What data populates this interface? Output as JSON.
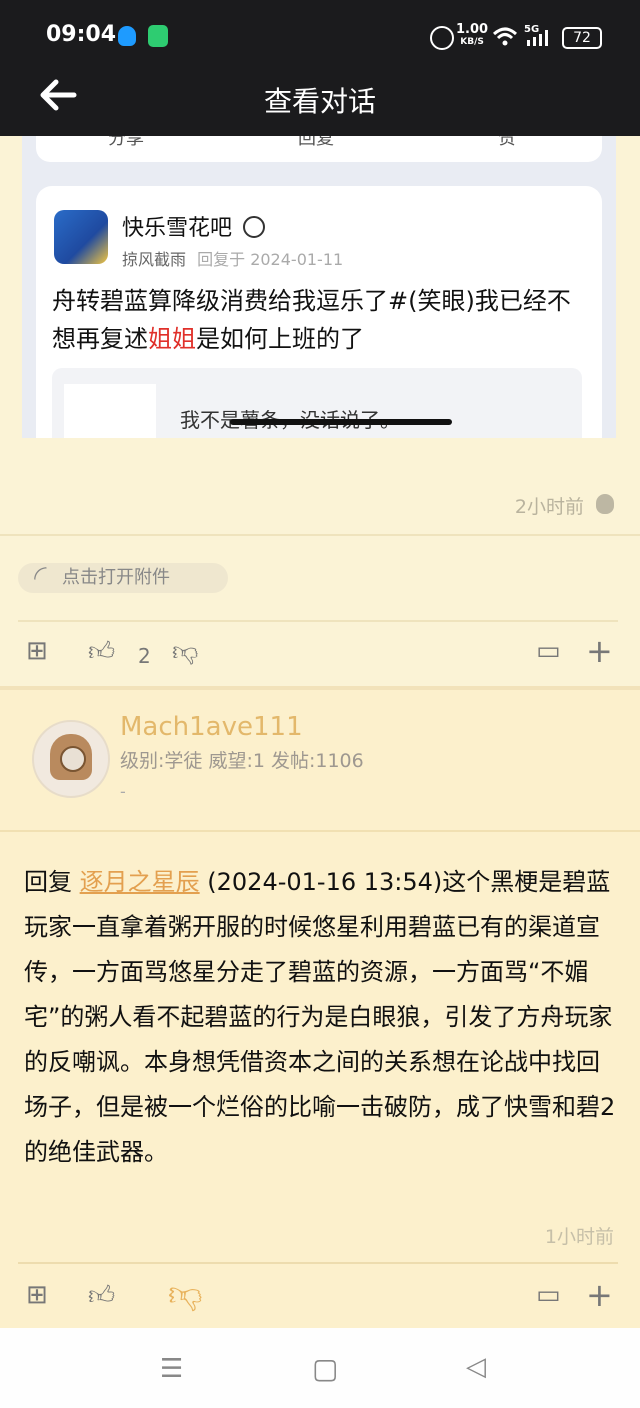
{
  "status": {
    "time": "09:04",
    "net_speed": "1.00",
    "net_unit": "KB/S",
    "network": "5G",
    "battery": "72"
  },
  "header": {
    "title": "查看对话",
    "back_icon": "arrow-left-icon"
  },
  "embedded": {
    "actions": [
      "分享",
      "回复",
      "赞"
    ],
    "forum_name": "快乐雪花吧",
    "author": "掠风截雨",
    "reply_meta": "回复于 2024-01-11",
    "text_before": "舟转碧蓝算降级消费给我逗乐了#(笑眼)我已经不想再复述",
    "text_highlight": "姐姐",
    "text_after": "是如何上班的了",
    "quote_text": "我不是薯条，没话说了。"
  },
  "post1": {
    "time": "2小时前",
    "attachment_label": "点击打开附件",
    "likes": "2"
  },
  "post2": {
    "username": "Mach1ave111",
    "stats": "级别:学徒 威望:1 发帖:1106",
    "signature": "-",
    "reply_prefix": "回复 ",
    "reply_user": "逐月之星辰",
    "reply_body": " (2024-01-16 13:54)这个黑梗是碧蓝玩家一直拿着粥开服的时候悠星利用碧蓝已有的渠道宣传，一方面骂悠星分走了碧蓝的资源，一方面骂“不媚宅”的粥人看不起碧蓝的行为是白眼狼，引发了方舟玩家的反嘲讽。本身想凭借资本之间的关系想在论战中找回场子，但是被一个烂俗的比喻一击破防，成了快雪和碧2的绝佳武器。",
    "time": "1小时前"
  },
  "navbar": {
    "menu_glyph": "☰",
    "home_glyph": "▢",
    "back_glyph": "◁"
  }
}
